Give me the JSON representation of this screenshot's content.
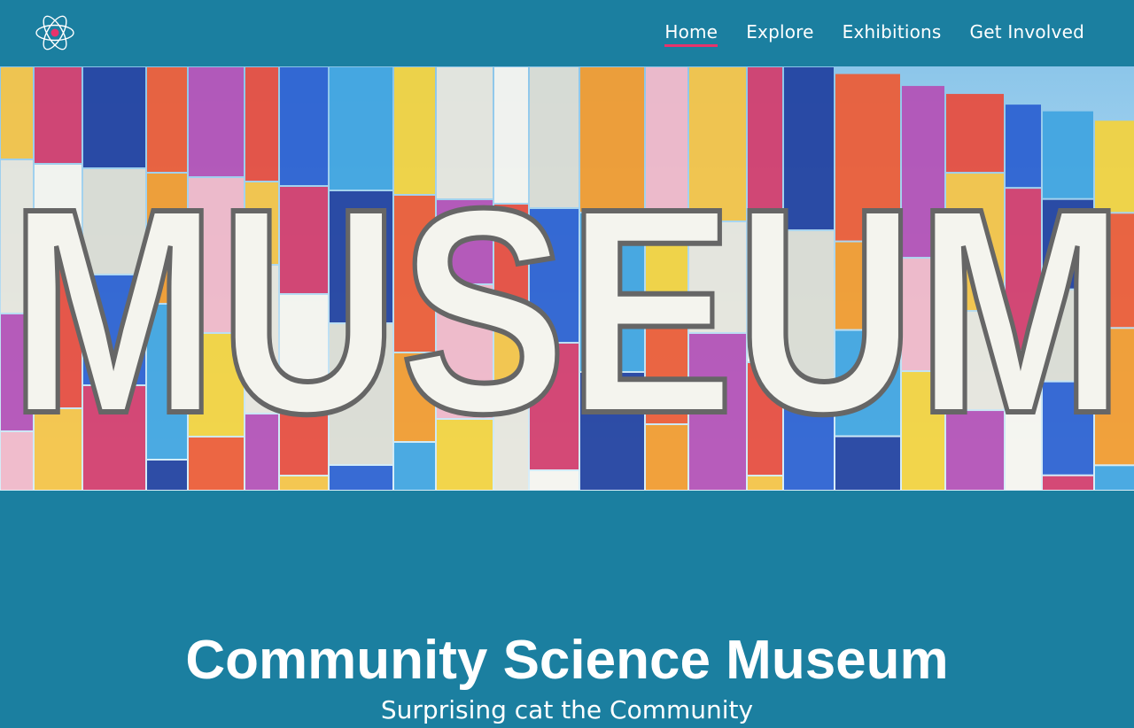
{
  "header": {
    "logo_icon": "atom-icon",
    "logo_accent_color": "#e8336b",
    "nav": [
      {
        "label": "Home",
        "active": true
      },
      {
        "label": "Explore",
        "active": false
      },
      {
        "label": "Exhibitions",
        "active": false
      },
      {
        "label": "Get Involved",
        "active": false
      }
    ]
  },
  "hero": {
    "image_word": "MUSEUM"
  },
  "main": {
    "title": "Community Science Museum",
    "subtitle": "Surprising cat the Community"
  },
  "colors": {
    "background": "#1b7fa0",
    "accent": "#e8336b",
    "text": "#ffffff"
  }
}
